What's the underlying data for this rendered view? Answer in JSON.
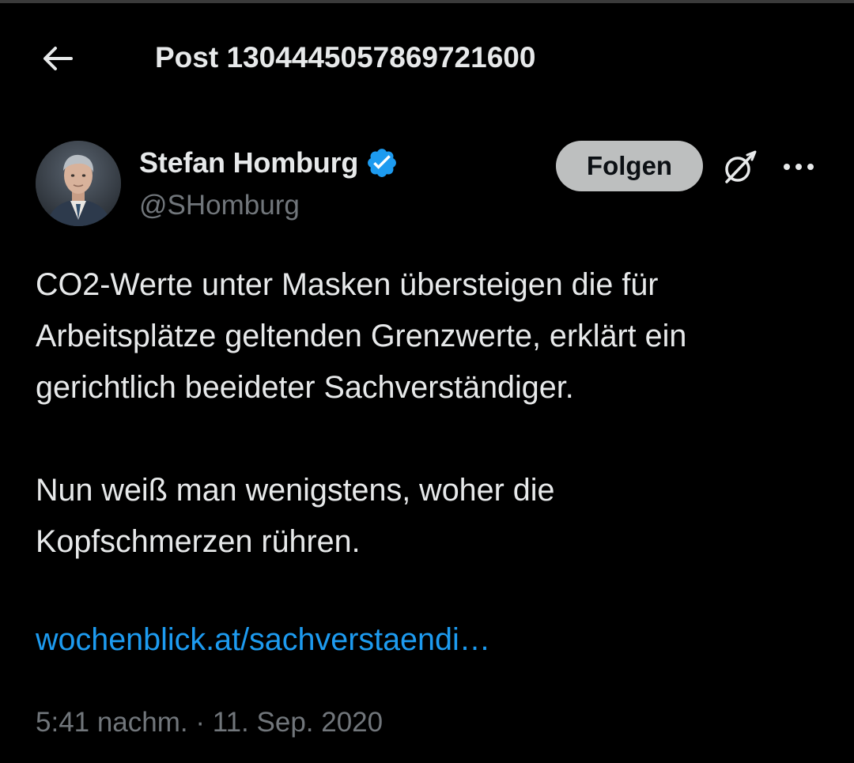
{
  "header": {
    "back_icon": "arrow-left-icon",
    "title": "Post 1304445057869721600"
  },
  "author": {
    "name": "Stefan Homburg",
    "handle": "@SHomburg",
    "verified_icon": "verified-badge-icon",
    "verified_color": "#1d9bf0"
  },
  "actions": {
    "follow_label": "Folgen",
    "grok_icon": "grok-icon",
    "more_icon": "more-dots-icon"
  },
  "post": {
    "paragraph1_line1": "CO2-Werte unter Masken übersteigen die für",
    "paragraph1_line2": "Arbeitsplätze geltenden Grenzwerte, erklärt ein",
    "paragraph1_line3": "gerichtlich beeideter Sachverständiger.",
    "paragraph2_line1": "Nun weiß man wenigstens, woher die",
    "paragraph2_line2": "Kopfschmerzen rühren.",
    "link_text": "wochenblick.at/sachverstaendi…",
    "link_color": "#1d9bf0",
    "timestamp": "5:41 nachm. · 11. Sep. 2020"
  },
  "colors": {
    "background": "#000000",
    "primary_text": "#e7e9ea",
    "secondary_text": "#71767b"
  }
}
